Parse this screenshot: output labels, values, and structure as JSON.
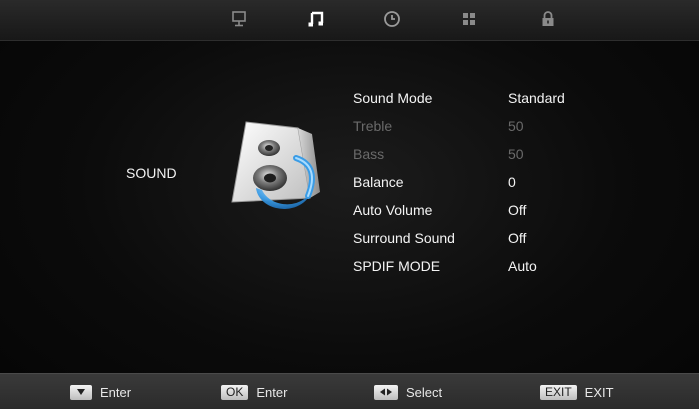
{
  "tabs": [
    {
      "icon": "picture-icon",
      "active": false
    },
    {
      "icon": "music-note-icon",
      "active": true
    },
    {
      "icon": "clock-icon",
      "active": false
    },
    {
      "icon": "grid-icon",
      "active": false
    },
    {
      "icon": "lock-icon",
      "active": false
    }
  ],
  "section": {
    "title": "SOUND",
    "illustration": "speaker-icon"
  },
  "menu": {
    "items": [
      {
        "label": "Sound Mode",
        "value": "Standard",
        "enabled": true
      },
      {
        "label": "Treble",
        "value": "50",
        "enabled": false
      },
      {
        "label": "Bass",
        "value": "50",
        "enabled": false
      },
      {
        "label": "Balance",
        "value": "0",
        "enabled": true
      },
      {
        "label": "Auto Volume",
        "value": "Off",
        "enabled": true
      },
      {
        "label": "Surround Sound",
        "value": "Off",
        "enabled": true
      },
      {
        "label": "SPDIF MODE",
        "value": "Auto",
        "enabled": true
      }
    ]
  },
  "footer": {
    "hints": [
      {
        "key": "",
        "key_icon": "down-arrow-icon",
        "label": "Enter"
      },
      {
        "key": "OK",
        "key_icon": "",
        "label": "Enter"
      },
      {
        "key": "",
        "key_icon": "left-right-arrows-icon",
        "label": "Select"
      },
      {
        "key": "EXIT",
        "key_icon": "",
        "label": "EXIT"
      }
    ]
  },
  "colors": {
    "background": "#0d0d0d",
    "text": "#f4f4f4",
    "disabled_text": "#6a6a6a",
    "accent_blue": "#2f9be8"
  }
}
